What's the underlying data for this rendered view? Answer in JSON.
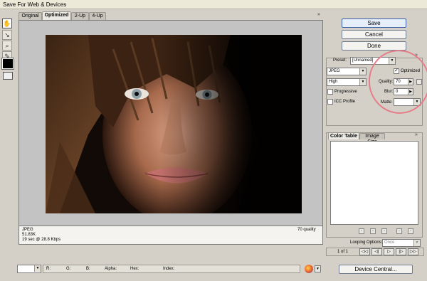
{
  "window": {
    "title": "Save For Web & Devices"
  },
  "view_tabs": [
    {
      "label": "Original"
    },
    {
      "label": "Optimized"
    },
    {
      "label": "2-Up"
    },
    {
      "label": "4-Up"
    }
  ],
  "expand_glyph": "»",
  "info": {
    "format": "JPEG",
    "size": "51.83K",
    "time": "19 sec @ 28.8 Kbps",
    "quality_label": "70 quality"
  },
  "buttons": {
    "save": "Save",
    "cancel": "Cancel",
    "done": "Done",
    "device_central": "Device Central..."
  },
  "settings": {
    "preset_label": "Preset:",
    "preset_value": "[Unnamed]",
    "format": "JPEG",
    "quality_level": "High",
    "optimized_label": "Optimized",
    "optimized_checked": true,
    "quality_label": "Quality:",
    "quality_value": "70",
    "blur_label": "Blur:",
    "blur_value": "0",
    "progressive_label": "Progressive",
    "icc_label": "ICC Profile",
    "matte_label": "Matte:"
  },
  "panel_tabs": [
    {
      "label": "Color Table"
    },
    {
      "label": "Image Size"
    }
  ],
  "looping": {
    "label": "Looping Options:",
    "value": "Once"
  },
  "frames": {
    "counter": "1 of 1",
    "controls": [
      "◁◁",
      "◁|",
      "▷",
      "|▷",
      "▷▷"
    ]
  },
  "status": {
    "r": "R:",
    "g": "G:",
    "b": "B:",
    "alpha": "Alpha:",
    "hex": "Hex:",
    "index": "Index:"
  },
  "icons": [
    "hand-tool-icon",
    "slice-select-icon",
    "zoom-icon",
    "eyedropper-icon",
    "color-swatch-icon",
    "toggle-slices-icon",
    "browser-preview-icon"
  ],
  "colors": {
    "accent_circle": "#e57d8a",
    "primary_button_border": "#3b5fa8"
  }
}
